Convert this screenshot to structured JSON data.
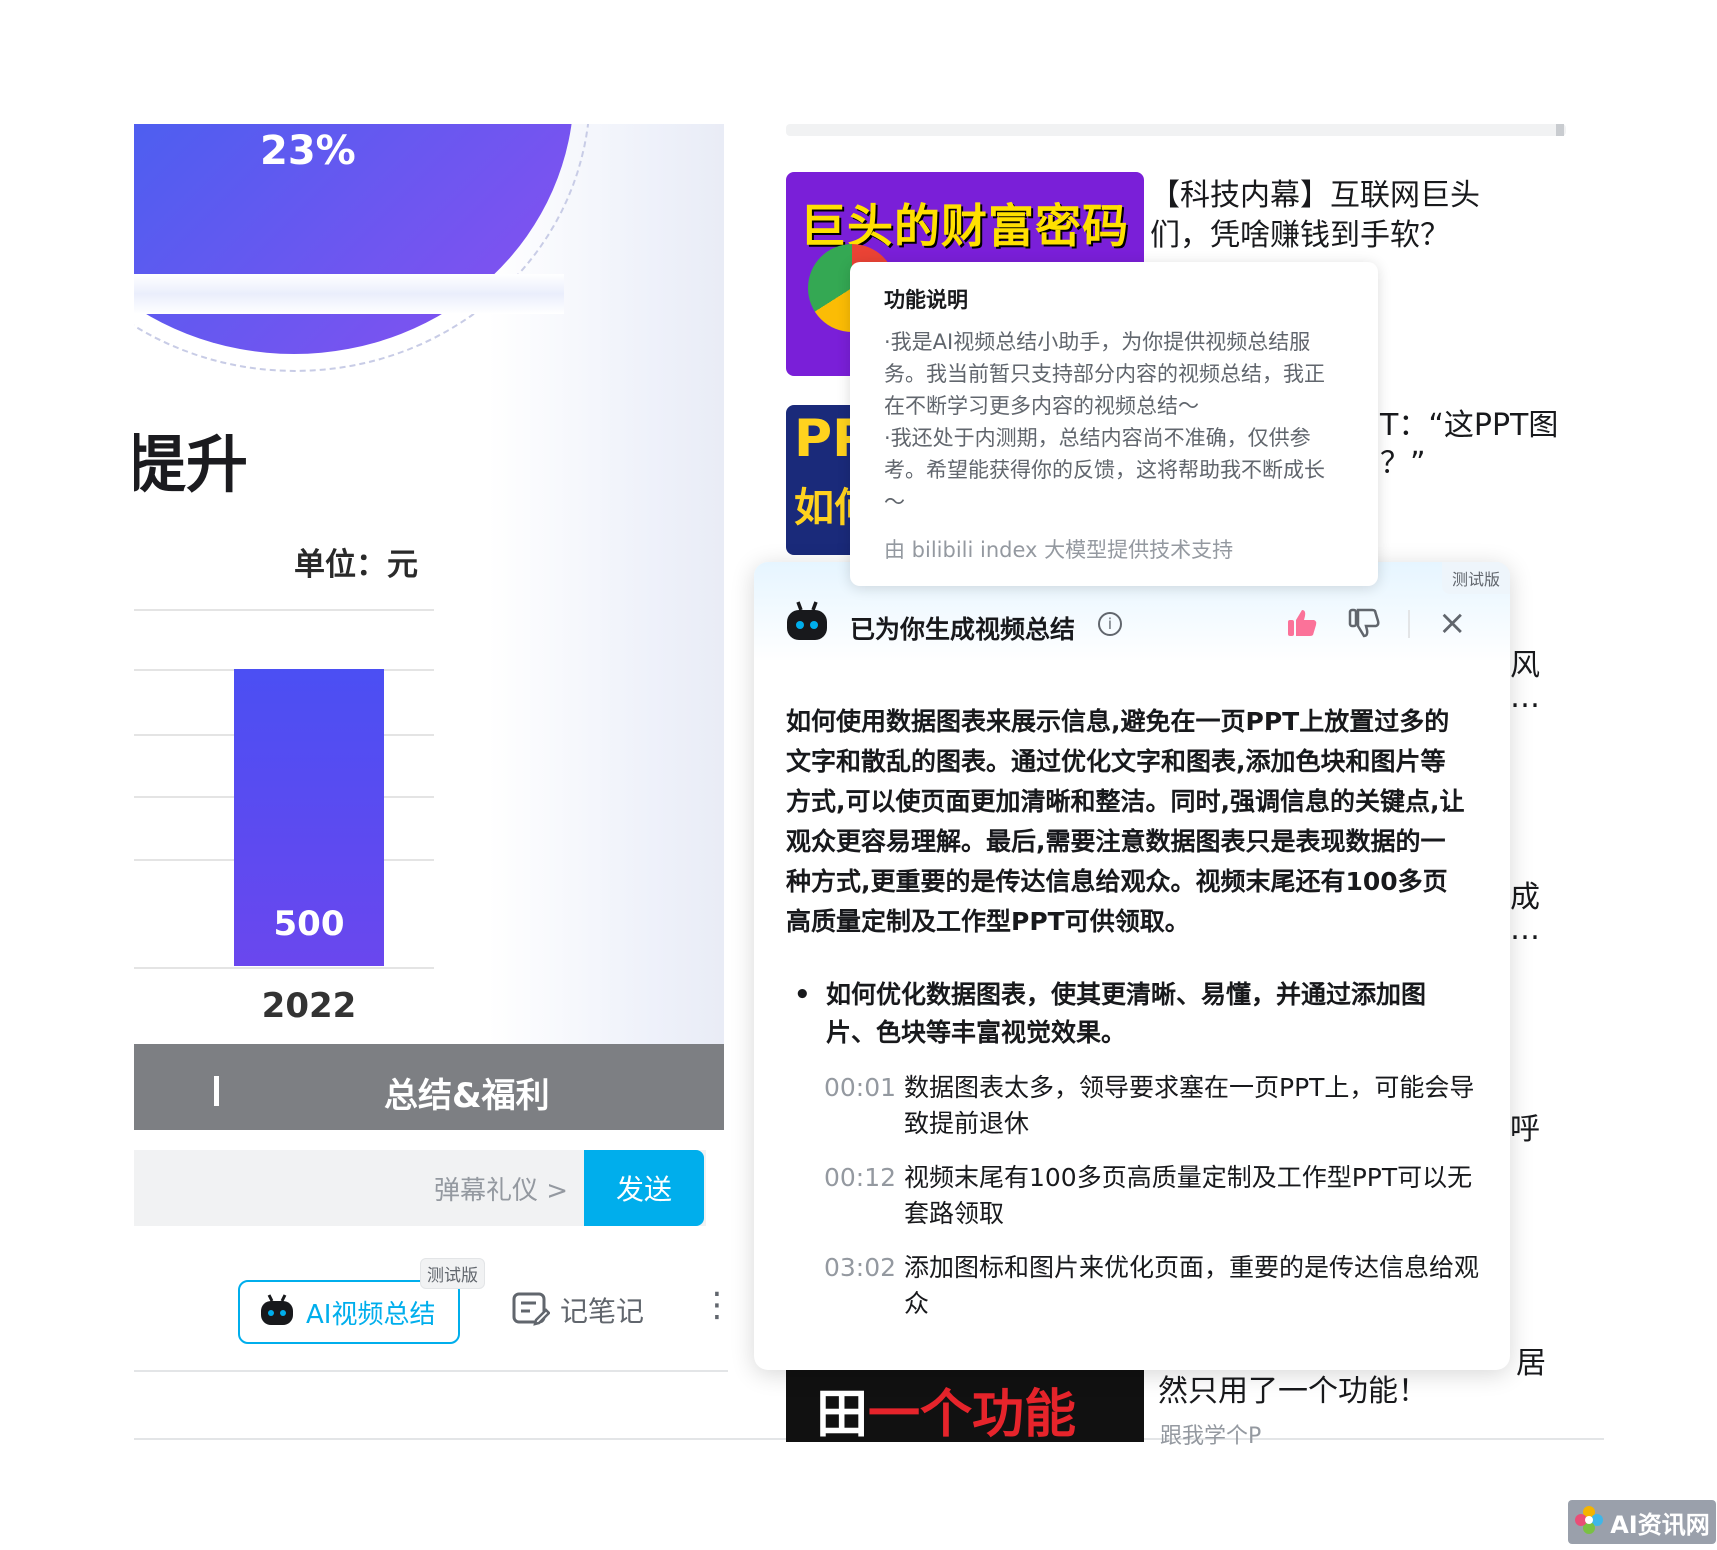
{
  "video": {
    "pie_percent": "23%",
    "heading": "提升",
    "unit_label": "单位：元",
    "chapter_title": "总结&福利"
  },
  "chart_data": {
    "type": "bar",
    "categories": [
      "2022"
    ],
    "values": [
      500
    ]
  },
  "danmaku": {
    "etiquette_link": "弹幕礼仪 >",
    "send_label": "发送"
  },
  "toolbar": {
    "ai_summary_label": "AI视频总结",
    "beta_badge": "测试版",
    "notes_label": "记笔记"
  },
  "recommendations": {
    "item1_title": "【科技内幕】互联网巨头们，凭啥赚钱到手软？",
    "item1_thumb_text": "巨头的财富密码",
    "item2_title_partial": "T：“这PPT图",
    "item2_title_partial2": "？”",
    "item2_thumb_text": "PP",
    "item2_thumb_sub": "如何",
    "item_last_title_a": "居",
    "item_last_title_b": "然只用了一个功能！",
    "item_last_thumb_a": "田",
    "item_last_thumb_b": "一个功能",
    "item_last_uploader": "跟我学个P",
    "peek1": "风",
    "peek2": "…",
    "peek3": "成",
    "peek4": "…",
    "peek5": "呼"
  },
  "tooltip": {
    "title": "功能说明",
    "line1": "·我是AI视频总结小助手，为你提供视频总结服务。我当前暂只支持部分内容的视频总结，我正在不断学习更多内容的视频总结～",
    "line2": "·我还处于内测期，总结内容尚不准确，仅供参考。希望能获得你的反馈，这将帮助我不断成长～",
    "footer": "由 bilibili index 大模型提供技术支持"
  },
  "panel": {
    "beta_badge": "测试版",
    "title": "已为你生成视频总结",
    "summary": "如何使用数据图表来展示信息,避免在一页PPT上放置过多的文字和散乱的图表。通过优化文字和图表,添加色块和图片等方式,可以使页面更加清晰和整洁。同时,强调信息的关键点,让观众更容易理解。最后,需要注意数据图表只是表现数据的一种方式,更重要的是传达信息给观众。视频末尾还有100多页高质量定制及工作型PPT可供领取。",
    "bullet": "如何优化数据图表，使其更清晰、易懂，并通过添加图片、色块等丰富视觉效果。",
    "points": [
      {
        "time": "00:01",
        "text": "数据图表太多，领导要求塞在一页PPT上，可能会导致提前退休"
      },
      {
        "time": "00:12",
        "text": "视频末尾有100多页高质量定制及工作型PPT可以无套路领取"
      },
      {
        "time": "03:02",
        "text": "添加图标和图片来优化页面，重要的是传达信息给观众"
      }
    ]
  },
  "watermark": {
    "text": "AI资讯网"
  },
  "colors": {
    "accent": "#00aeec",
    "like": "#fb7299",
    "bar": "#4b4ff3"
  }
}
